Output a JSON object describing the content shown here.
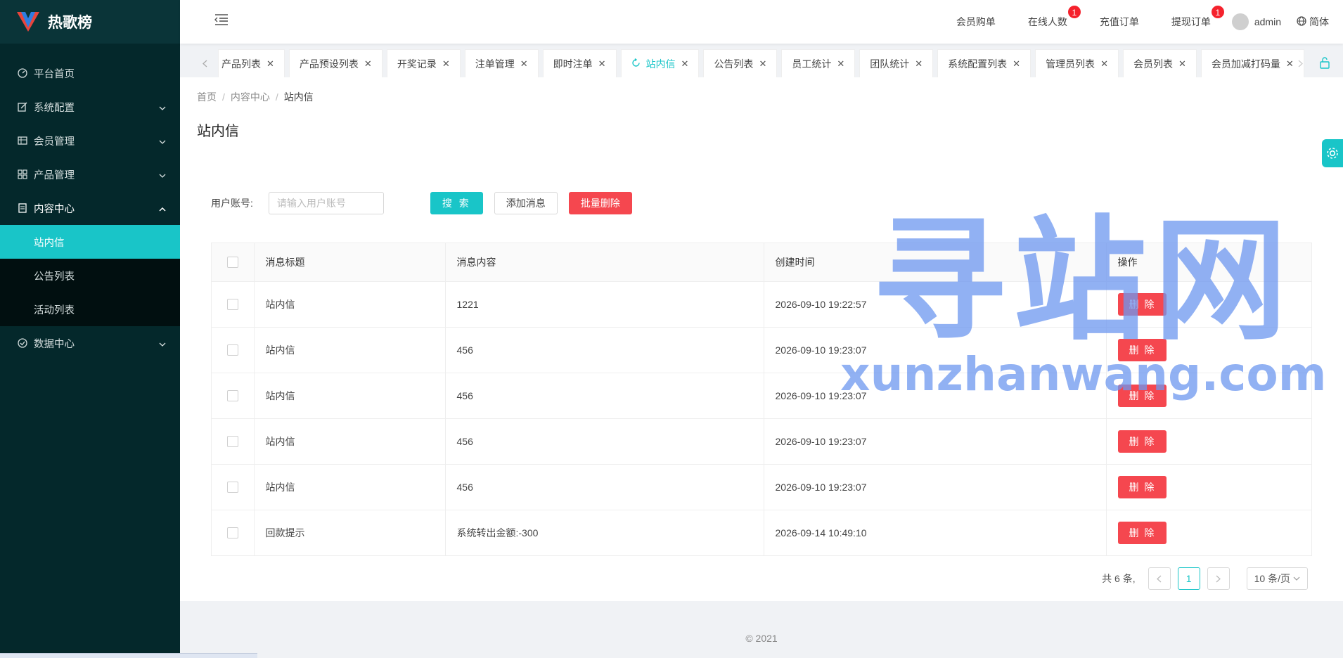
{
  "app": {
    "title": "热歌榜"
  },
  "sidebar": {
    "items": [
      {
        "label": "平台首页",
        "icon": "dashboard-icon"
      },
      {
        "label": "系统配置",
        "icon": "edit-icon"
      },
      {
        "label": "会员管理",
        "icon": "table-icon"
      },
      {
        "label": "产品管理",
        "icon": "grid-icon"
      },
      {
        "label": "内容中心",
        "icon": "document-icon"
      },
      {
        "label": "数据中心",
        "icon": "check-circle-icon"
      }
    ],
    "content_submenu": [
      {
        "label": "站内信"
      },
      {
        "label": "公告列表"
      },
      {
        "label": "活动列表"
      }
    ]
  },
  "header": {
    "links": [
      {
        "label": "会员购单",
        "badge": null
      },
      {
        "label": "在线人数",
        "badge": "1"
      },
      {
        "label": "充值订单",
        "badge": null
      },
      {
        "label": "提现订单",
        "badge": "1"
      }
    ],
    "user": "admin",
    "language": "简体"
  },
  "tabs": [
    {
      "label": "产品列表"
    },
    {
      "label": "产品预设列表"
    },
    {
      "label": "开奖记录"
    },
    {
      "label": "注单管理"
    },
    {
      "label": "即时注单"
    },
    {
      "label": "站内信"
    },
    {
      "label": "公告列表"
    },
    {
      "label": "员工统计"
    },
    {
      "label": "团队统计"
    },
    {
      "label": "系统配置列表"
    },
    {
      "label": "管理员列表"
    },
    {
      "label": "会员列表"
    },
    {
      "label": "会员加减打码量"
    }
  ],
  "breadcrumb": {
    "home": "首页",
    "section": "内容中心",
    "current": "站内信"
  },
  "page": {
    "title": "站内信"
  },
  "filter": {
    "label": "用户账号:",
    "placeholder": "请输入用户账号",
    "search_label": "搜 索",
    "add_label": "添加消息",
    "bulk_delete_label": "批量删除"
  },
  "table": {
    "headers": {
      "title": "消息标题",
      "content": "消息内容",
      "created": "创建时间",
      "actions": "操作"
    },
    "delete_label": "删 除",
    "rows": [
      {
        "title": "站内信",
        "content": "1221",
        "created": "2026-09-10 19:22:57"
      },
      {
        "title": "站内信",
        "content": "456",
        "created": "2026-09-10 19:23:07"
      },
      {
        "title": "站内信",
        "content": "456",
        "created": "2026-09-10 19:23:07"
      },
      {
        "title": "站内信",
        "content": "456",
        "created": "2026-09-10 19:23:07"
      },
      {
        "title": "站内信",
        "content": "456",
        "created": "2026-09-10 19:23:07"
      },
      {
        "title": "回款提示",
        "content": "系统转出金额:-300",
        "created": "2026-09-14 10:49:10"
      }
    ]
  },
  "pagination": {
    "total": "共 6 条,",
    "current": "1",
    "page_size": "10 条/页"
  },
  "footer": {
    "text": "2021"
  },
  "watermark": {
    "main": "寻站网",
    "sub": "xunzhanwang.com"
  },
  "colors": {
    "accent": "#19c5c8",
    "danger": "#f5474f",
    "sidebar": "#04282b"
  }
}
